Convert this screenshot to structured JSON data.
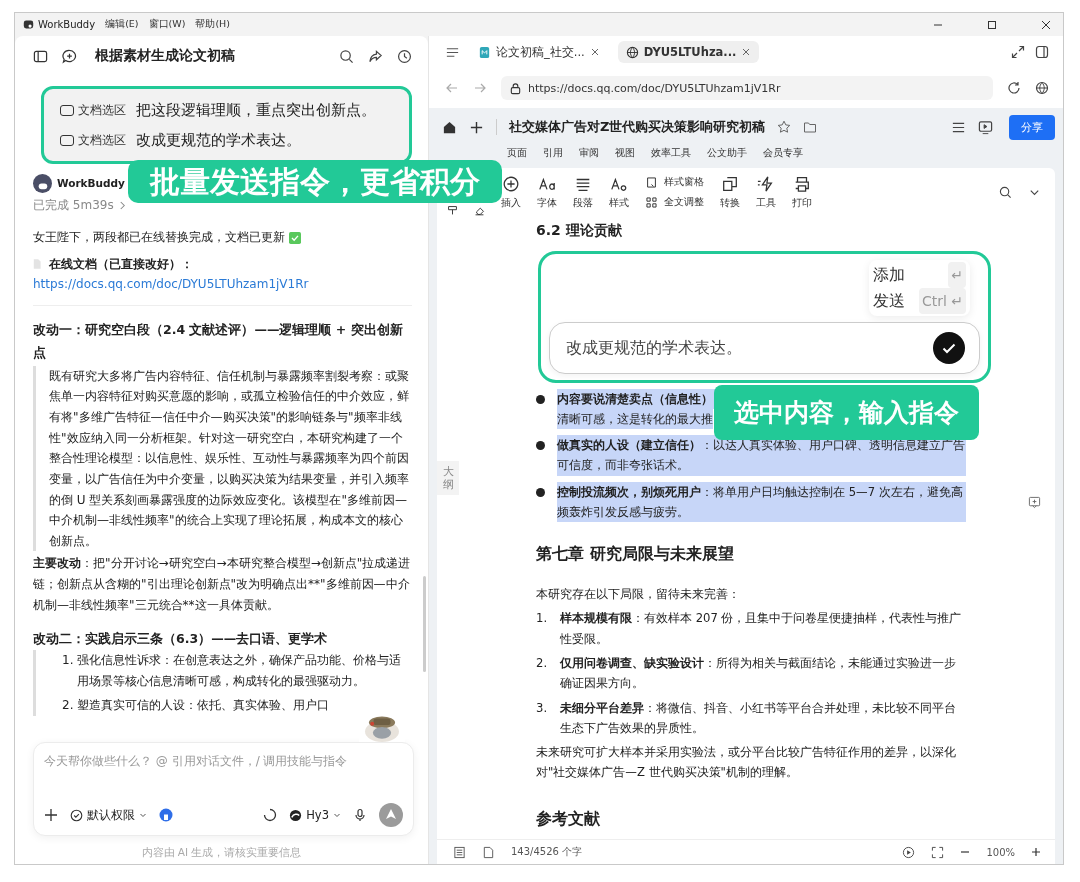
{
  "app": {
    "name": "WorkBuddy",
    "menus": [
      "编辑(E)",
      "窗口(W)",
      "帮助(H)"
    ]
  },
  "chat": {
    "title": "根据素材生成论文初稿",
    "user_message": [
      {
        "tag": "文档选区",
        "text": "把这段逻辑理顺，重点突出创新点。"
      },
      {
        "tag": "文档选区",
        "text": "改成更规范的学术表达。"
      }
    ],
    "banner": "批量发送指令，更省积分",
    "assistant": {
      "name": "WorkBuddy",
      "status": "已完成 5m39s",
      "intro": "女王陛下，两段都已在线替换完成，文档已更新",
      "doc_label": "在线文档（已直接改好）：",
      "link": "https://docs.qq.com/doc/DYU5LTUhzam1jV1Rr",
      "sections": [
        {
          "heading": "改动一：研究空白段（2.4 文献述评）——逻辑理顺 + 突出创新点",
          "quote": "既有研究大多将广告内容特征、信任机制与暴露频率割裂考察：或聚焦单一内容特征对购买意愿的影响，或孤立检验信任的中介效应，鲜有将\"多维广告特征—信任中介—购买决策\"的影响链条与\"频率非线性\"效应纳入同一分析框架。针对这一研究空白，本研究构建了一个整合性理论模型：以信息性、娱乐性、互动性与暴露频率为四个前因变量，以广告信任为中介变量，以购买决策为结果变量，并引入频率的倒 U 型关系刻画暴露强度的边际效应变化。该模型在\"多维前因—中介机制—非线性频率\"的统合上实现了理论拓展，构成本文的核心创新点。",
          "note_label": "主要改动",
          "note": "：把\"分开讨论→研究空白→本研究整合模型→创新点\"拉成递进链；创新点从含糊的\"引出理论创新点\"改为明确点出**\"多维前因—中介机制—非线性频率\"三元统合**这一具体贡献。"
        },
        {
          "heading": "改动二：实践启示三条（6.3）——去口语、更学术",
          "items": [
            {
              "num": "1.",
              "text": "强化信息性诉求：在创意表达之外，确保产品功能、价格与适用场景等核心信息清晰可感，构成转化的最强驱动力。"
            },
            {
              "num": "2.",
              "text": "塑造真实可信的人设：依托、真实体验、用户口"
            }
          ]
        }
      ]
    },
    "input": {
      "placeholder": "今天帮你做些什么？ @ 引用对话文件，/ 调用技能与指令",
      "permission": "默认权限",
      "model": "Hy3"
    },
    "disclaimer": "内容由 AI 生成，请核实重要信息"
  },
  "browser": {
    "tabs": [
      {
        "label": "论文初稿_社交...",
        "kind": "doc",
        "selected": false
      },
      {
        "label": "DYU5LTUhza...",
        "kind": "web",
        "selected": true
      }
    ],
    "url": "https://docs.qq.com/doc/DYU5LTUhzam1jV1Rr"
  },
  "document": {
    "title": "社交媒体广告对Z世代购买决策影响研究初稿",
    "share": "分享",
    "menu_tabs": [
      "页面",
      "引用",
      "审阅",
      "视图",
      "效率工具",
      "公文助手",
      "会员专享"
    ],
    "toolbar": [
      {
        "kind": "insert",
        "label": "插入"
      },
      {
        "kind": "font",
        "label": "字体"
      },
      {
        "kind": "paragraph",
        "label": "段落"
      },
      {
        "kind": "style",
        "label": "样式"
      },
      {
        "kind": "pane",
        "label": "样式窗格"
      },
      {
        "kind": "adjust",
        "label": "全文调整"
      },
      {
        "kind": "convert",
        "label": "转换"
      },
      {
        "kind": "tools",
        "label": "工具"
      },
      {
        "kind": "print",
        "label": "打印"
      }
    ],
    "outline_tab": "大纲",
    "section_heading": "6.2  理论贡献",
    "popup": [
      {
        "label": "添加",
        "key": "↵"
      },
      {
        "label": "发送",
        "key": "Ctrl ↵"
      }
    ],
    "instruction_value": "改成更规范的学术表达。",
    "banner": "选中内容，输入指令",
    "bullets": [
      {
        "text": "**内容要说清楚卖点（信息性）**：",
        "continuation": "清晰可感，这是转化的最大推",
        "selected": true
      },
      {
        "text": "**做真实的人设（建立信任）**：以达人真实体验、用户口碑、透明信息建立广告可信度，而非夸张话术。",
        "selected": true
      },
      {
        "text": "**控制投流频次，别烦死用户**：将单用户日均触达控制在  5—7  次左右，避免高频轰炸引发反感与疲劳。",
        "selected": true
      }
    ],
    "chapter_heading": "第七章  研究局限与未来展望",
    "lead": "本研究存在以下局限，留待未来完善：",
    "limits": [
      {
        "num": "1.",
        "text": "**样本规模有限**：有效样本  207  份，且集中于问卷星便捷抽样，代表性与推广性受限。"
      },
      {
        "num": "2.",
        "text": "**仅用问卷调查、缺实验设计**：所得为相关与截面结论，未能通过实验进一步确证因果方向。"
      },
      {
        "num": "3.",
        "text": "**未细分平台差异**：将微信、抖音、小红书等平台合并处理，未比较不同平台生态下广告效果的异质性。"
      }
    ],
    "outlook": "未来研究可扩大样本并采用实验法，或分平台比较广告特征作用的差异，以深化对\"社交媒体广告—Z  世代购买决策\"机制的理解。",
    "references_heading": "参考文献",
    "word_count": "143/4526 个字",
    "zoom": "100%"
  }
}
